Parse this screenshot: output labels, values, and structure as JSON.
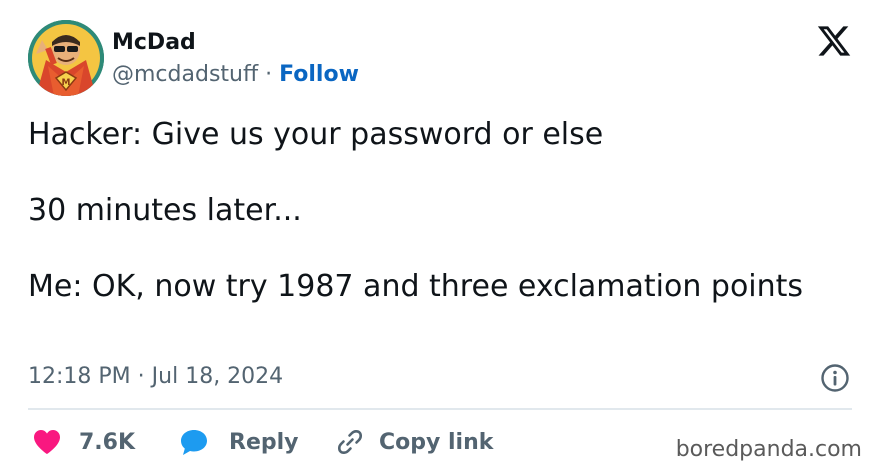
{
  "author": {
    "name": "McDad",
    "handle": "@mcdadstuff",
    "separator": "·",
    "follow_label": "Follow"
  },
  "tweet": {
    "paragraphs": [
      "Hacker: Give us your password or else",
      "30 minutes later...",
      "Me: OK, now try 1987 and three exclamation points"
    ],
    "time": "12:18 PM",
    "date_separator": "·",
    "date": "Jul 18, 2024"
  },
  "actions": {
    "like_count": "7.6K",
    "reply_label": "Reply",
    "copy_label": "Copy link"
  },
  "colors": {
    "accent": "#0a66c2",
    "like": "#f91880",
    "reply": "#1d9bf0",
    "muted": "#536471"
  },
  "watermark": "boredpanda.com"
}
